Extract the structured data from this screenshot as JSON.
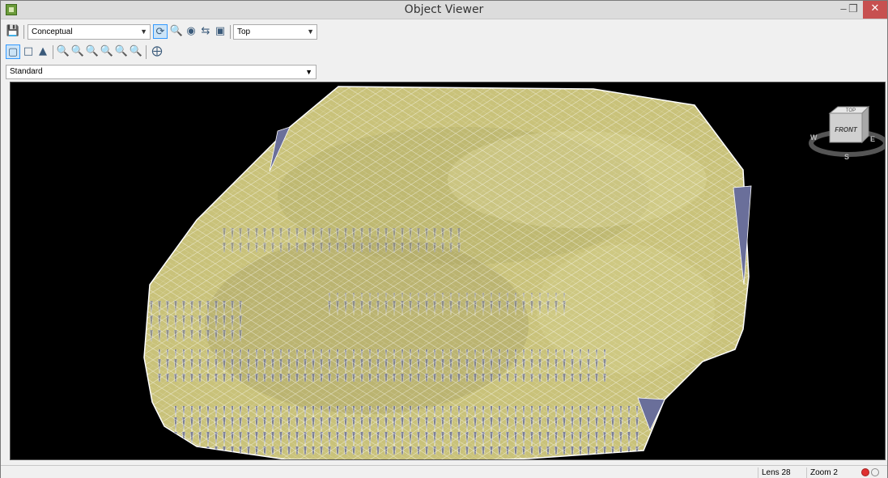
{
  "window": {
    "title": "Object Viewer",
    "min_glyph": "–",
    "max_glyph": "❐",
    "close_glyph": "✕"
  },
  "toolbar1": {
    "visual_style": "Conceptual",
    "view": "Top",
    "icons": [
      "save-icon",
      "orbit-icon",
      "zoom-icon",
      "swivel-icon",
      "walk-icon",
      "camera-icon"
    ]
  },
  "toolbar2": {
    "icons": [
      "3d-box-icon",
      "3d-box-alt-icon",
      "perspective-icon",
      "zoom-extents-icon",
      "zoom-window-icon",
      "zoom-center-icon",
      "zoom-in-icon",
      "zoom-out-icon",
      "zoom-all-icon",
      "pan-icon"
    ]
  },
  "view_preset": "Standard",
  "viewcube": {
    "face_label": "FRONT",
    "top_label": "TOP",
    "west": "W",
    "east": "E",
    "south": "S"
  },
  "status": {
    "lens": "Lens 28",
    "zoom": "Zoom 2"
  },
  "colors": {
    "terrain": "#c9c27a",
    "terrain_shadow": "#8e8850",
    "mesh_edge": "#ffffff",
    "gap": "#6a6f9a",
    "background": "#000000"
  }
}
